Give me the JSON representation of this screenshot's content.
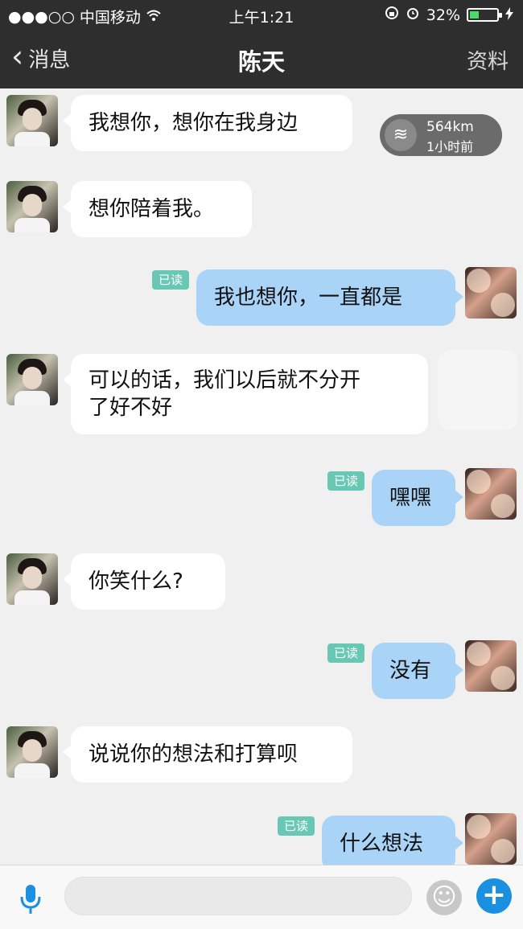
{
  "status_bar": {
    "signal": "●●●○○",
    "carrier": "中国移动",
    "wifi_icon": "wifi-icon",
    "time": "上午1:21",
    "battery_percent": "32%"
  },
  "nav": {
    "back_label": "消息",
    "title": "陈天",
    "right_label": "资料"
  },
  "distance_badge": {
    "distance": "564km",
    "time_ago": "1小时前"
  },
  "messages": [
    {
      "side": "in",
      "text": "我想你，想你在我身边"
    },
    {
      "side": "in",
      "text": "想你陪着我。"
    },
    {
      "side": "out",
      "text": "我也想你，一直都是",
      "status": "已读"
    },
    {
      "side": "in",
      "text": "可以的话，我们以后就不分开\n了好不好"
    },
    {
      "side": "out",
      "text": "嘿嘿",
      "status": "已读"
    },
    {
      "side": "in",
      "text": "你笑什么?"
    },
    {
      "side": "out",
      "text": "没有",
      "status": "已读"
    },
    {
      "side": "in",
      "text": "说说你的想法和打算呗"
    },
    {
      "side": "out",
      "text": "什么想法",
      "status": "已读"
    }
  ],
  "input": {
    "placeholder": ""
  },
  "colors": {
    "outgoing_bubble": "#a9d4f7",
    "incoming_bubble": "#ffffff",
    "read_badge": "#68c8b3",
    "accent": "#1b8fe0"
  }
}
